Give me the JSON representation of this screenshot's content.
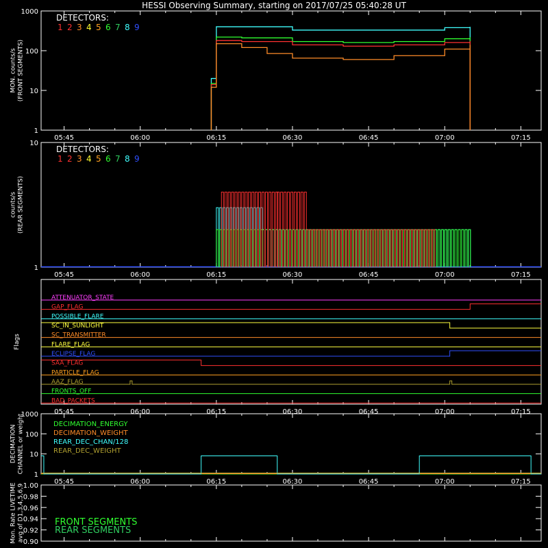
{
  "title": "HESSI Observing Summary, starting on 2017/07/25 05:40:28 UT",
  "colors": {
    "bg": "#000000",
    "axis": "#ffffff",
    "d1": "#ff3030",
    "d2": "#ff3030",
    "d3": "#ff8c28",
    "d4": "#ffff30",
    "d5": "#ffa020",
    "d6": "#30ff30",
    "d7": "#30d060",
    "d8": "#40ffff",
    "d9": "#3050ff"
  },
  "time_ticks": [
    "05:45",
    "06:00",
    "06:15",
    "06:30",
    "06:45",
    "07:00",
    "07:15"
  ],
  "time_range": [
    "05:40:28",
    "07:19"
  ],
  "chart_data": [
    {
      "type": "line",
      "id": "front",
      "ylabel": "MON. counts/s\n(FRONT SEGMENTS)",
      "y_scale": "log",
      "ylim": [
        1,
        1000
      ],
      "y_ticks": [
        "1",
        "10",
        "100",
        "1000"
      ],
      "legend_title": "DETECTORS:",
      "legend_numbers": [
        "1",
        "2",
        "3",
        "4",
        "5",
        "6",
        "7",
        "8",
        "9"
      ],
      "series": [
        {
          "name": "8",
          "color": "#40ffff",
          "x": [
            "06:14",
            "06:15",
            "06:20",
            "06:30",
            "06:40",
            "06:50",
            "07:00",
            "07:05"
          ],
          "y": [
            20,
            400,
            400,
            330,
            330,
            330,
            380,
            400
          ]
        },
        {
          "name": "6",
          "color": "#30ff30",
          "x": [
            "06:14",
            "06:15",
            "06:20",
            "06:30",
            "06:40",
            "06:50",
            "07:00",
            "07:05"
          ],
          "y": [
            15,
            220,
            210,
            170,
            160,
            170,
            200,
            220
          ]
        },
        {
          "name": "1",
          "color": "#ff3030",
          "x": [
            "06:14",
            "06:15",
            "06:20",
            "06:30",
            "06:40",
            "06:50",
            "07:00",
            "07:05"
          ],
          "y": [
            14,
            180,
            170,
            140,
            130,
            140,
            160,
            175
          ]
        },
        {
          "name": "3",
          "color": "#ff8c28",
          "x": [
            "06:14",
            "06:15",
            "06:20",
            "06:25",
            "06:30",
            "06:40",
            "06:50",
            "07:00",
            "07:05"
          ],
          "y": [
            12,
            150,
            120,
            85,
            65,
            60,
            75,
            110,
            140
          ]
        }
      ]
    },
    {
      "type": "line",
      "id": "rear",
      "ylabel": "counts/s\n(REAR SEGMENTS)",
      "y_scale": "log",
      "ylim": [
        1,
        10
      ],
      "y_ticks": [
        "1",
        "10"
      ],
      "legend_title": "DETECTORS:",
      "legend_numbers": [
        "1",
        "2",
        "3",
        "4",
        "5",
        "6",
        "7",
        "8",
        "9"
      ],
      "series": [
        {
          "name": "8",
          "color": "#40ffff",
          "x": [
            "06:15",
            "06:24",
            "06:30",
            "06:40",
            "06:50",
            "07:00",
            "07:05"
          ],
          "y": [
            3,
            2,
            2,
            2,
            2,
            2,
            2
          ]
        },
        {
          "name": "6",
          "color": "#30ff30",
          "x": [
            "06:15",
            "06:24",
            "06:30",
            "06:40",
            "06:50",
            "07:00",
            "07:05"
          ],
          "y": [
            2,
            2,
            2,
            2,
            2,
            2,
            2
          ]
        },
        {
          "name": "1",
          "color": "#ff3030",
          "x": [
            "06:16",
            "06:27",
            "06:33",
            "06:43",
            "06:58"
          ],
          "y": [
            4,
            4,
            2,
            2,
            2
          ]
        }
      ]
    },
    {
      "type": "line",
      "id": "flags",
      "ylabel": "Flags",
      "flags": [
        {
          "label": "ATTENUATOR_STATE",
          "color": "#ff40ff"
        },
        {
          "label": "GAP_FLAG",
          "color": "#ff3030"
        },
        {
          "label": "POSSIBLE_FLARE",
          "color": "#40ffff"
        },
        {
          "label": "SC_IN_SUNLIGHT",
          "color": "#ffff40"
        },
        {
          "label": "SC_TRANSMITTER",
          "color": "#ff8c28"
        },
        {
          "label": "FLARE_FLAG",
          "color": "#ffff40"
        },
        {
          "label": "ECLIPSE_FLAG",
          "color": "#3050ff"
        },
        {
          "label": "SAA_FLAG",
          "color": "#ff3030"
        },
        {
          "label": "PARTICLE_FLAG",
          "color": "#ffa020"
        },
        {
          "label": "AAZ_FLAG",
          "color": "#b0a030"
        },
        {
          "label": "FRONTS_OFF",
          "color": "#30ff30"
        },
        {
          "label": "BAD_PACKETS",
          "color": "#ff3030"
        }
      ]
    },
    {
      "type": "line",
      "id": "decimation",
      "ylabel": "DECIMATION\nCHANNEL or weight",
      "y_scale": "log",
      "ylim": [
        1,
        1000
      ],
      "y_ticks": [
        "1",
        "10",
        "100",
        "1000"
      ],
      "series": [
        {
          "name": "DECIMATION_ENERGY",
          "color": "#30ff30",
          "y": [
            1
          ]
        },
        {
          "name": "DECIMATION_WEIGHT",
          "color": "#ff8c28",
          "y": [
            1
          ]
        },
        {
          "name": "REAR_DEC_CHAN/128",
          "color": "#40ffff",
          "x": [
            "05:40:28",
            "05:41",
            "06:12",
            "06:27",
            "06:55",
            "07:17"
          ],
          "y": [
            8,
            1,
            8,
            1,
            8,
            1
          ]
        },
        {
          "name": "REAR_DEC_WEIGHT",
          "color": "#b0a030",
          "y": [
            1
          ]
        }
      ]
    },
    {
      "type": "line",
      "id": "livetime",
      "ylabel": "Mon. Rate LIVETIME\navg of D1,3,4,5,6,9",
      "ylim": [
        0.9,
        1.0
      ],
      "y_ticks": [
        "0.90",
        "0.92",
        "0.94",
        "0.96",
        "0.98",
        "1.00"
      ],
      "legend": [
        {
          "name": "FRONT SEGMENTS",
          "color": "#30ff30"
        },
        {
          "name": "REAR SEGMENTS",
          "color": "#30d060"
        }
      ]
    }
  ]
}
